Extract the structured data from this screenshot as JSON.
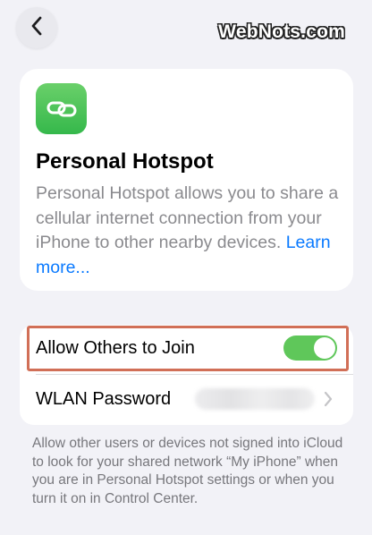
{
  "nav": {
    "back_icon": "chevron-left-icon"
  },
  "watermark": "WebNots.com",
  "hotspot": {
    "icon": "link-icon",
    "icon_color": "#4cc55b",
    "title": "Personal Hotspot",
    "description": "Personal Hotspot allows you to share a cellular internet connection from your iPhone to other nearby devices.",
    "learn_more": "Learn more..."
  },
  "settings": {
    "allow_others_label": "Allow Others to Join",
    "allow_others_on": true,
    "toggle_color": "#5fc75a",
    "wlan_password_label": "WLAN Password",
    "highlight_color": "#d16f57"
  },
  "footer_note": "Allow other users or devices not signed into iCloud to look for your shared network “My iPhone” when you are in Personal Hotspot settings or when you turn it on in Control Center."
}
